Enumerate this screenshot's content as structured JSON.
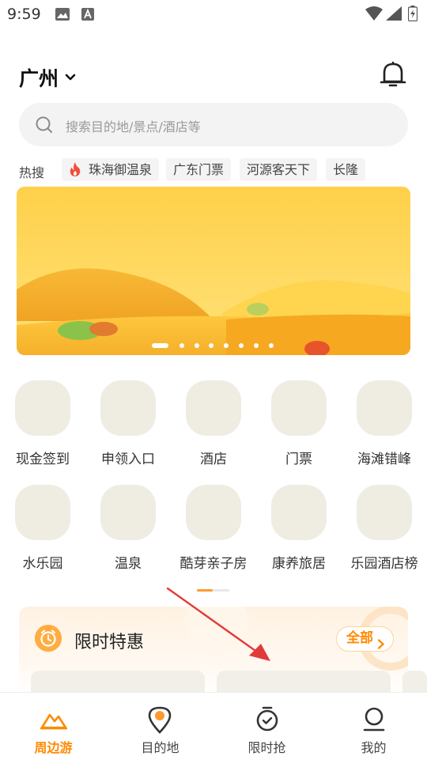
{
  "status_bar": {
    "time": "9:59"
  },
  "header": {
    "city": "广州"
  },
  "search": {
    "placeholder": "搜索目的地/景点/酒店等"
  },
  "hot_search": {
    "label": "热搜",
    "tags": [
      "珠海御温泉",
      "广东门票",
      "河源客天下",
      "长隆"
    ]
  },
  "categories": [
    {
      "label": "现金签到"
    },
    {
      "label": "申领入口"
    },
    {
      "label": "酒店"
    },
    {
      "label": "门票"
    },
    {
      "label": "海滩错峰"
    },
    {
      "label": "水乐园"
    },
    {
      "label": "温泉"
    },
    {
      "label": "酷芽亲子房"
    },
    {
      "label": "康养旅居"
    },
    {
      "label": "乐园酒店榜"
    }
  ],
  "flash_deals": {
    "title": "限时特惠",
    "all_label": "全部"
  },
  "bottom_nav": [
    {
      "label": "周边游",
      "icon": "mountain-icon",
      "active": true
    },
    {
      "label": "目的地",
      "icon": "location-pin-icon",
      "active": false
    },
    {
      "label": "限时抢",
      "icon": "stopwatch-icon",
      "active": false
    },
    {
      "label": "我的",
      "icon": "person-icon",
      "active": false
    }
  ],
  "colors": {
    "accent": "#ff8a00",
    "icon_bg": "#efece2"
  }
}
